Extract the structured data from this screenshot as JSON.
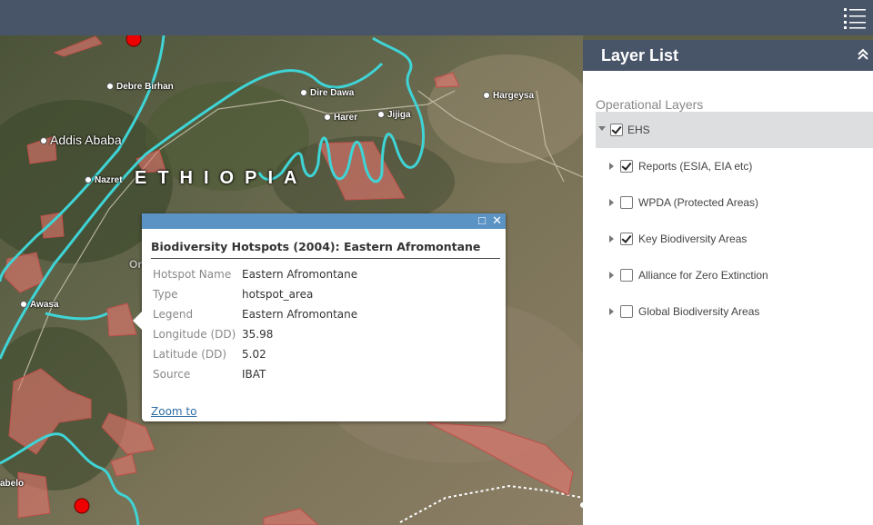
{
  "map": {
    "country_label": "ETHIOPIA",
    "cities": [
      {
        "name": "Debre Birhan"
      },
      {
        "name": "Dire Dawa"
      },
      {
        "name": "Hargeysa"
      },
      {
        "name": "Harer"
      },
      {
        "name": "Jijiga"
      },
      {
        "name": "Addis Ababa"
      },
      {
        "name": "Nazret"
      },
      {
        "name": "Awasa"
      },
      {
        "name": "abelo"
      }
    ],
    "partial_label": "Or"
  },
  "popup": {
    "title": "Biodiversity Hotspots (2004): Eastern Afromontane",
    "maximize_glyph": "□",
    "close_glyph": "✕",
    "attributes": [
      {
        "key": "Hotspot Name",
        "value": "Eastern Afromontane"
      },
      {
        "key": "Type",
        "value": "hotspot_area"
      },
      {
        "key": "Legend",
        "value": "Eastern Afromontane"
      },
      {
        "key": "Longitude (DD)",
        "value": "35.98"
      },
      {
        "key": "Latitude (DD)",
        "value": "5.02"
      },
      {
        "key": "Source",
        "value": "IBAT"
      }
    ],
    "zoom_label": "Zoom to"
  },
  "panel": {
    "title": "Layer List",
    "operational_label": "Operational Layers",
    "group": {
      "name": "EHS",
      "checked": true,
      "expanded": true
    },
    "layers": [
      {
        "name": "Reports (ESIA, EIA etc)",
        "checked": true
      },
      {
        "name": "WPDA (Protected Areas)",
        "checked": false
      },
      {
        "name": "Key Biodiversity Areas",
        "checked": true
      },
      {
        "name": "Alliance for Zero Extinction",
        "checked": false
      },
      {
        "name": "Global Biodiversity Areas",
        "checked": false
      }
    ]
  },
  "icons": {
    "layer_list": "layer-list-icon",
    "collapse": "double-chevron-up-icon",
    "maximize": "maximize-icon",
    "close": "close-icon"
  },
  "colors": {
    "header": "#485468",
    "popup_header": "#5b93c5",
    "link": "#2e6da4",
    "boundary": "#3fd4d6",
    "hotspot_fill": "#e8766f"
  }
}
